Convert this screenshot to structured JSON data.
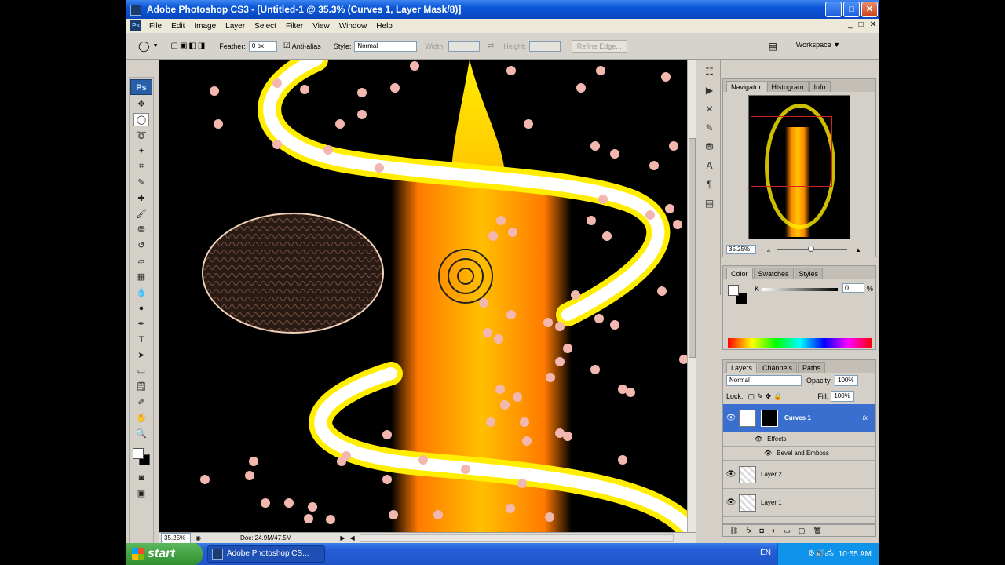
{
  "window": {
    "title": "Adobe Photoshop CS3 - [Untitled-1 @ 35.3% (Curves 1, Layer Mask/8)]",
    "minimize": "_",
    "maximize": "□",
    "close": "✕"
  },
  "menu": {
    "app_icon": "Ps",
    "items": [
      "File",
      "Edit",
      "Image",
      "Layer",
      "Select",
      "Filter",
      "View",
      "Window",
      "Help"
    ],
    "doc_min": "_",
    "doc_max": "□",
    "doc_close": "✕"
  },
  "options": {
    "feather_label": "Feather:",
    "feather_value": "0 px",
    "antialias_label": "Anti-alias",
    "style_label": "Style:",
    "style_value": "Normal",
    "width_label": "Width:",
    "height_label": "Height:",
    "refine_edge": "Refine Edge...",
    "workspace_label": "Workspace ▼"
  },
  "toolbox": {
    "logo": "Ps"
  },
  "status": {
    "zoom": "35.25%",
    "doc": "Doc: 24.9M/47.5M"
  },
  "navigator": {
    "tabs": [
      "Navigator",
      "Histogram",
      "Info"
    ],
    "zoom": "35.25%"
  },
  "color": {
    "tabs": [
      "Color",
      "Swatches",
      "Styles"
    ],
    "channel": "K",
    "value": "0",
    "percent": "%"
  },
  "layers": {
    "tabs": [
      "Layers",
      "Channels",
      "Paths"
    ],
    "blend_mode": "Normal",
    "opacity_label": "Opacity:",
    "opacity_value": "100%",
    "lock_label": "Lock:",
    "fill_label": "Fill:",
    "fill_value": "100%",
    "rows": [
      {
        "name": "Curves 1",
        "fx": "fx"
      },
      {
        "name": "Effects"
      },
      {
        "name": "Bevel and Emboss"
      },
      {
        "name": "Layer 2"
      },
      {
        "name": "Layer 1"
      }
    ]
  },
  "taskbar": {
    "start": "start",
    "task": "Adobe Photoshop CS...",
    "lang": "EN",
    "time": "10:55 AM"
  },
  "colors": {
    "accent": "#0a56d8",
    "candle_orange": "#ff8a00",
    "ribbon_yellow": "#ffee00"
  }
}
